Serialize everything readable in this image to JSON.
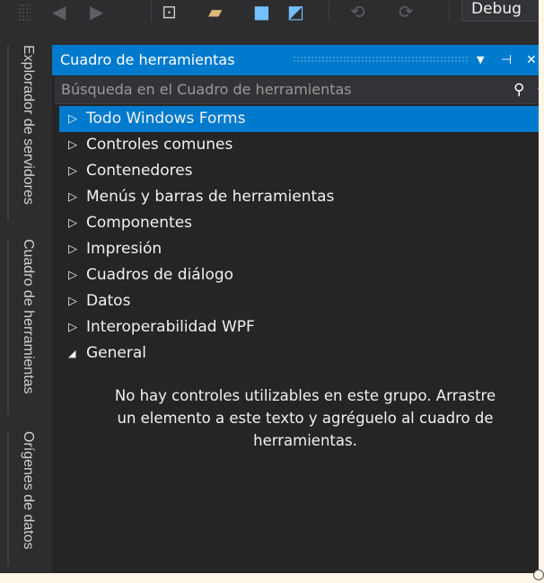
{
  "toolbar": {
    "debug_label": "Debug",
    "icons": [
      "back-icon",
      "forward-icon",
      "new-item-icon",
      "open-folder-icon",
      "save-icon",
      "save-all-icon",
      "undo-icon",
      "redo-icon"
    ]
  },
  "side_tabs": [
    {
      "label": "Explorador de servidores"
    },
    {
      "label": "Cuadro de herramientas"
    },
    {
      "label": "Orígenes de datos"
    }
  ],
  "panel": {
    "title": "Cuadro de herramientas",
    "title_icons": {
      "dropdown": "▼",
      "pin": "⊣",
      "close": "✕"
    },
    "search_placeholder": "Búsqueda en el Cuadro de herramientas",
    "search_icon": "⚲",
    "items": [
      {
        "label": "Todo Windows Forms",
        "arrow": "▷",
        "selected": true
      },
      {
        "label": "Controles comunes",
        "arrow": "▷"
      },
      {
        "label": "Contenedores",
        "arrow": "▷"
      },
      {
        "label": "Menús y barras de herramientas",
        "arrow": "▷"
      },
      {
        "label": "Componentes",
        "arrow": "▷"
      },
      {
        "label": "Impresión",
        "arrow": "▷"
      },
      {
        "label": "Cuadros de diálogo",
        "arrow": "▷"
      },
      {
        "label": "Datos",
        "arrow": "▷"
      },
      {
        "label": "Interoperabilidad WPF",
        "arrow": "▷"
      },
      {
        "label": "General",
        "arrow": "◢"
      }
    ],
    "empty_message": [
      "No hay controles utilizables en este grupo. Arrastre",
      "un elemento a este texto y agréguelo al cuadro de",
      "herramientas."
    ]
  },
  "colors": {
    "accent": "#007acc",
    "panel_bg": "#252526",
    "chrome_bg": "#2d2d30",
    "text": "#f1f1f1"
  }
}
